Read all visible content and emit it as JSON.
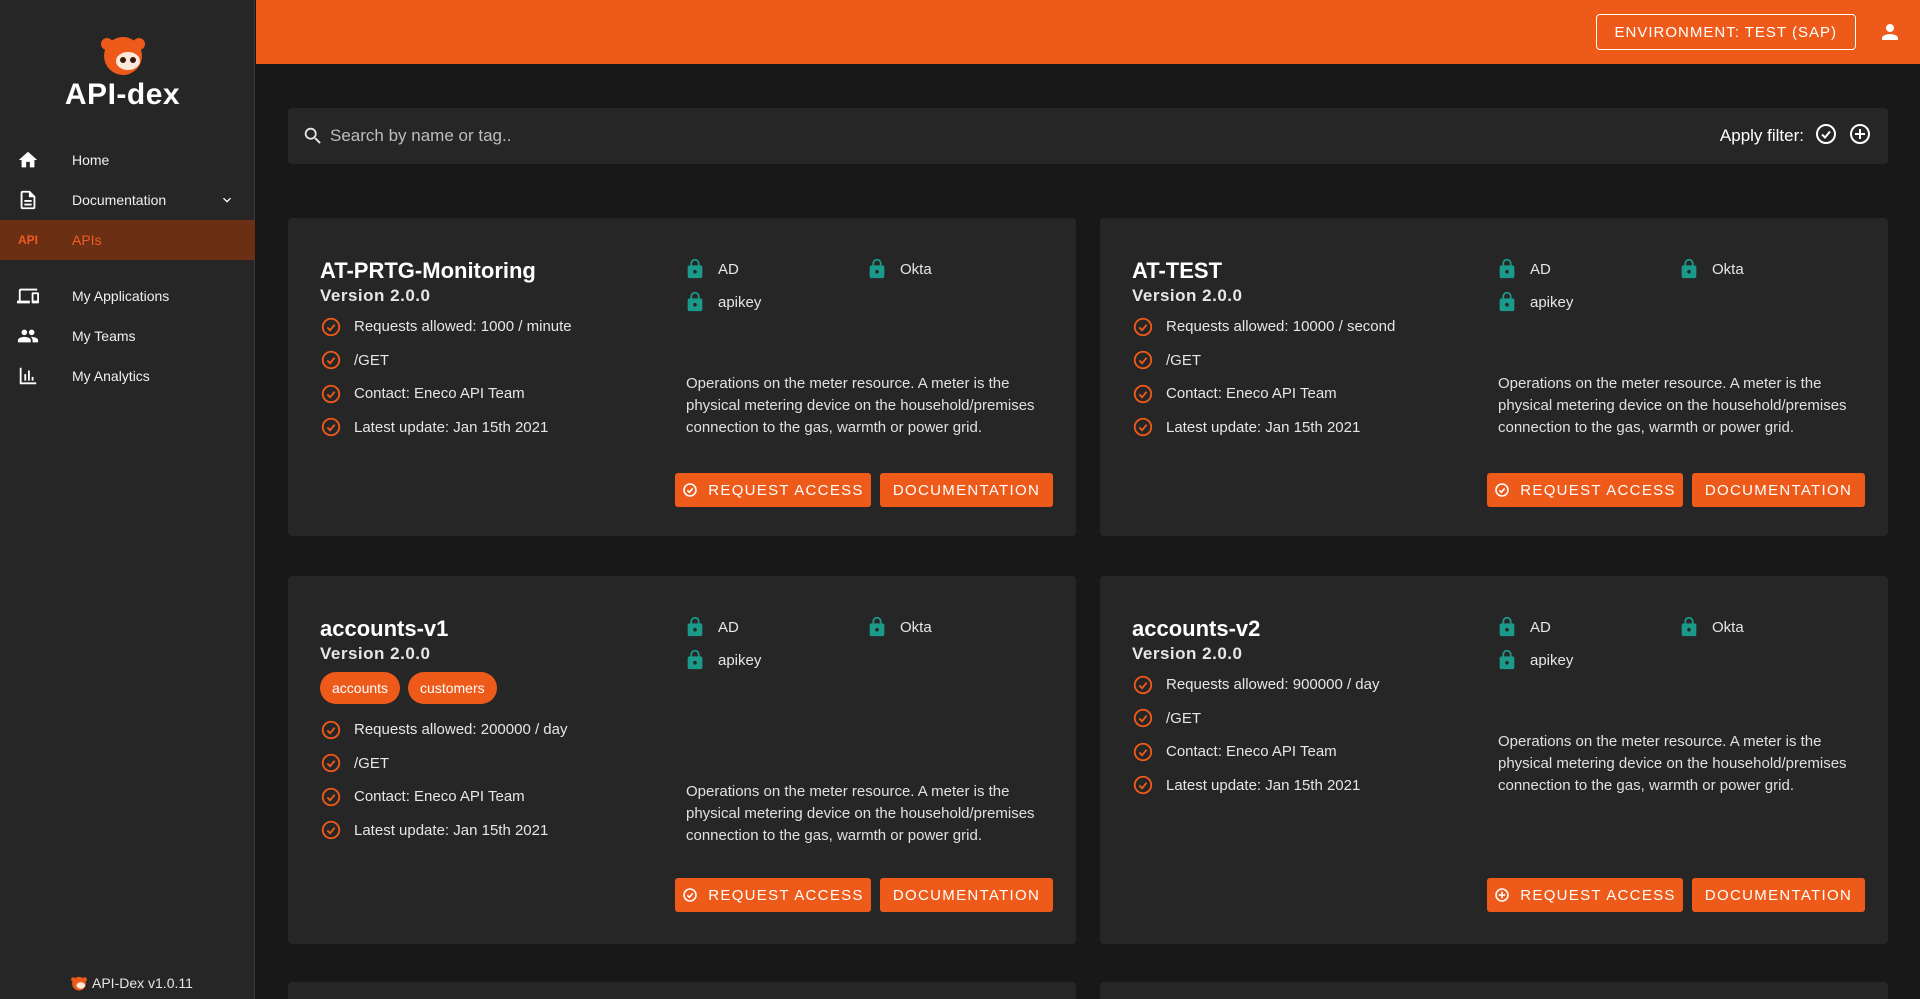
{
  "app": {
    "brand": "API-dex",
    "version_label": "API-Dex v1.0.11"
  },
  "sidebar": {
    "items": [
      {
        "label": "Home",
        "icon": "home-icon"
      },
      {
        "label": "Documentation",
        "icon": "document-icon"
      },
      {
        "label": "APIs",
        "icon": "api-icon",
        "icon_text": "API",
        "active": true
      },
      {
        "label": "My Applications",
        "icon": "devices-icon"
      },
      {
        "label": "My Teams",
        "icon": "people-icon"
      },
      {
        "label": "My Analytics",
        "icon": "bar-chart-icon"
      }
    ]
  },
  "topbar": {
    "environment_label": "ENVIRONMENT: TEST (SAP)",
    "color": "#ee5a1a"
  },
  "search": {
    "placeholder": "Search by name or tag..",
    "apply_filter_label": "Apply filter:"
  },
  "colors": {
    "accent": "#ee5a1a",
    "lock": "#1a9a8a",
    "card": "#262626",
    "background": "#181818"
  },
  "cards": [
    {
      "title": "AT-PRTG-Monitoring",
      "version": "Version 2.0.0",
      "tags": [],
      "facts": [
        "Requests allowed: 1000 / minute",
        "/GET",
        "Contact: Eneco API Team",
        "Latest update: Jan 15th 2021"
      ],
      "auth": [
        "AD",
        "Okta",
        "apikey"
      ],
      "description": "Operations on the meter resource. A meter is the physical metering device on the household/premises connection to the gas, warmth or power grid.",
      "request_label": "REQUEST ACCESS",
      "request_icon": "check-circle-icon",
      "doc_label": "DOCUMENTATION"
    },
    {
      "title": "AT-TEST",
      "version": "Version 2.0.0",
      "tags": [],
      "facts": [
        "Requests allowed: 10000 / second",
        "/GET",
        "Contact: Eneco API Team",
        "Latest update: Jan 15th 2021"
      ],
      "auth": [
        "AD",
        "Okta",
        "apikey"
      ],
      "description": "Operations on the meter resource. A meter is the physical metering device on the household/premises connection to the gas, warmth or power grid.",
      "request_label": "REQUEST ACCESS",
      "request_icon": "check-circle-icon",
      "doc_label": "DOCUMENTATION"
    },
    {
      "title": "accounts-v1",
      "version": "Version 2.0.0",
      "tags": [
        "accounts",
        "customers"
      ],
      "facts": [
        "Requests allowed: 200000 / day",
        "/GET",
        "Contact: Eneco API Team",
        "Latest update: Jan 15th 2021"
      ],
      "auth": [
        "AD",
        "Okta",
        "apikey"
      ],
      "description": "Operations on the meter resource. A meter is the physical metering device on the household/premises connection to the gas, warmth or power grid.",
      "request_label": "REQUEST ACCESS",
      "request_icon": "check-circle-icon",
      "doc_label": "DOCUMENTATION"
    },
    {
      "title": "accounts-v2",
      "version": "Version 2.0.0",
      "tags": [],
      "facts": [
        "Requests allowed: 900000 / day",
        "/GET",
        "Contact: Eneco API Team",
        "Latest update: Jan 15th 2021"
      ],
      "auth": [
        "AD",
        "Okta",
        "apikey"
      ],
      "description": "Operations on the meter resource. A meter is the physical metering device on the household/premises connection to the gas, warmth or power grid.",
      "request_label": "REQUEST ACCESS",
      "request_icon": "plus-circle-icon",
      "doc_label": "DOCUMENTATION"
    }
  ]
}
